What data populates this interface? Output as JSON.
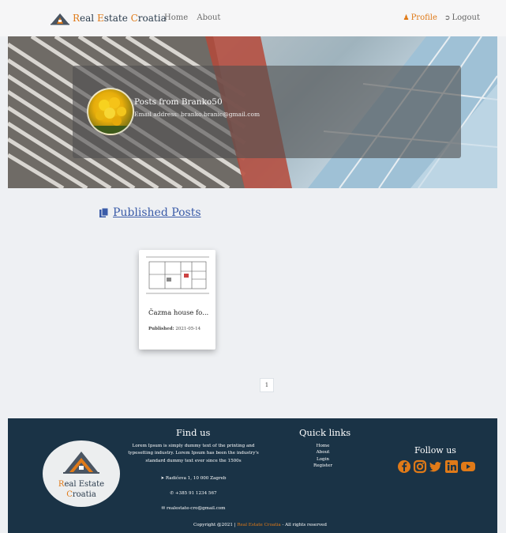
{
  "navbar": {
    "brand_r": "R",
    "brand_eal": "eal ",
    "brand_e": "E",
    "brand_state": "state ",
    "brand_c": "C",
    "brand_roatia": "roatia",
    "links": [
      "Home",
      "About"
    ],
    "profile_label": "Profile",
    "logout_label": "Logout",
    "accent_color": "#e07a18"
  },
  "profile": {
    "title": "Posts from Branko50",
    "email": "Email address: branko.branic@gmail.com"
  },
  "posts_section": {
    "title": "Published Posts",
    "icon": "copy-icon",
    "posts": [
      {
        "title": "Čazma house fo...",
        "published_label": "Published:",
        "published_date": "2021-05-14",
        "thumbnail": "floor-plan-image"
      }
    ]
  },
  "pagination": {
    "current_page": "1"
  },
  "footer": {
    "logo_line1_a": "R",
    "logo_line1_b": "eal Estate",
    "logo_line2_a": "C",
    "logo_line2_b": "roatia",
    "find_us_title": "Find us",
    "lorem": "Lorem Ipsum is simply dummy text of the printing and typesetting industry. Lorem Ipsum has been the industry's standard dummy text ever since the 1500s",
    "address": "Radićeva 1, 10 000 Zagreb",
    "phone": "+385 91 1234 567",
    "email": "realestate-cro@gmail.com",
    "quick_links_title": "Quick links",
    "quick_links": [
      "Home",
      "About",
      "Login",
      "Register"
    ],
    "follow_title": "Follow us",
    "social_icons": [
      "facebook-icon",
      "instagram-icon",
      "twitter-icon",
      "linkedin-icon",
      "youtube-icon"
    ],
    "copyright_prefix": "Copyright @2021 | ",
    "copyright_brand": "Real Estate Croatia",
    "copyright_suffix": " - All rights reserved",
    "background_color": "#1a3346"
  }
}
